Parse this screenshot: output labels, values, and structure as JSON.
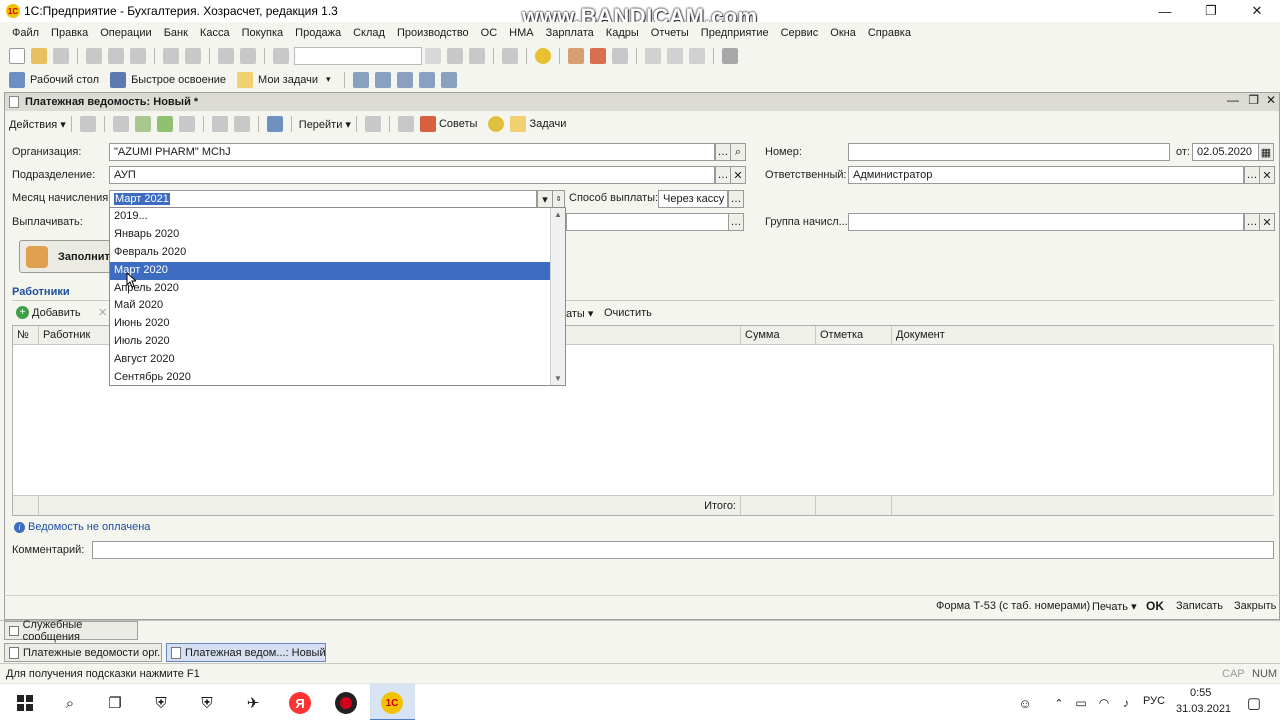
{
  "window": {
    "title": "1С:Предприятие - Бухгалтерия. Хозрасчет, редакция 1.3",
    "logo_text": "1С",
    "controls": [
      "—",
      "❐",
      "✕"
    ]
  },
  "watermark": "www.BANDICAM.com",
  "menu": [
    "Файл",
    "Правка",
    "Операции",
    "Банк",
    "Касса",
    "Покупка",
    "Продажа",
    "Склад",
    "Производство",
    "ОС",
    "НМА",
    "Зарплата",
    "Кадры",
    "Отчеты",
    "Предприятие",
    "Сервис",
    "Окна",
    "Справка"
  ],
  "panel_toolbar": {
    "desktop": "Рабочий стол",
    "quick_start": "Быстрое освоение",
    "my_tasks": "Мои задачи"
  },
  "document": {
    "title": "Платежная ведомость: Новый *",
    "toolbar": {
      "actions": "Действия",
      "goto": "Перейти",
      "tips": "Советы",
      "tasks": "Задачи"
    },
    "fields": {
      "org_label": "Организация:",
      "org_value": "\"AZUMI PHARM\" MChJ",
      "dept_label": "Подразделение:",
      "dept_value": "АУП",
      "month_label": "Месяц начисления:",
      "month_value": "Март 2021",
      "payout_label": "Выплачивать:",
      "pay_method_label": "Способ выплаты:",
      "pay_method_value": "Через кассу",
      "number_label": "Номер:",
      "number_value": "",
      "date_label": "от:",
      "date_value": "02.05.2020",
      "responsible_label": "Ответственный:",
      "responsible_value": "Администратор",
      "group_label": "Группа начисл...:",
      "group_value": ""
    },
    "fill_button": "Заполнить",
    "workers_title": "Работники",
    "workers_toolbar": {
      "add": "Добавить",
      "payments_tail": "аты",
      "clear": "Очистить"
    },
    "grid_columns": [
      "№",
      "Работник",
      "Сумма",
      "Отметка",
      "Документ"
    ],
    "grid_total_label": "Итого:",
    "status_note": "Ведомость не оплачена",
    "comment_label": "Комментарий:",
    "comment_value": "",
    "footer": {
      "form_t53": "Форма Т-53 (с таб. номерами)",
      "print": "Печать",
      "ok": "OK",
      "save": "Записать",
      "close": "Закрыть"
    }
  },
  "dropdown": {
    "options": [
      "2019...",
      "Январь 2020",
      "Февраль 2020",
      "Март 2020",
      "Апрель 2020",
      "Май 2020",
      "Июнь 2020",
      "Июль 2020",
      "Август 2020",
      "Сентябрь 2020"
    ],
    "selected_index": 3
  },
  "service_messages": "Служебные сообщения",
  "window_tabs": [
    "Платежные ведомости орг...",
    "Платежная ведом...: Новый *"
  ],
  "statusbar": {
    "hint": "Для получения подсказки нажмите F1",
    "cap": "CAP",
    "num": "NUM"
  },
  "taskbar": {
    "lang": "РУС",
    "time": "0:55",
    "date": "31.03.2021"
  },
  "colors": {
    "selection": "#3d6cc0",
    "link": "#1d4fa0",
    "record_red": "#d0021b",
    "yandex_red": "#f33"
  }
}
